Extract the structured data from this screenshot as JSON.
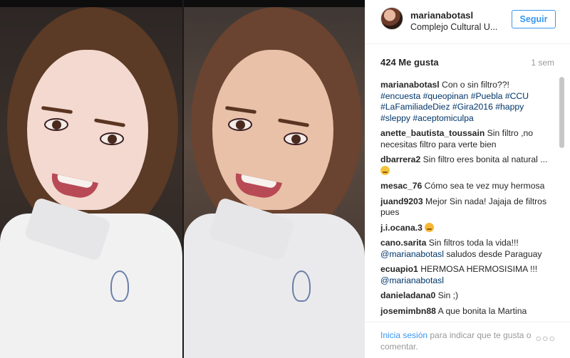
{
  "post": {
    "username": "marianabotasl",
    "location": "Complejo Cultural U...",
    "follow_label": "Seguir",
    "likes": "424 Me gusta",
    "time": "1 sem"
  },
  "caption": {
    "user": "marianabotasl",
    "text": " Con o sin filtro??! ",
    "tags": "#encuesta #queopinan #Puebla #CCU #LaFamiliadeDiez #Gira2016 #happy #sleppy #aceptomiculpa"
  },
  "comments": [
    {
      "user": "anette_bautista_toussain",
      "text": " Sin filtro ,no necesitas filtro para verte bien",
      "mention": ""
    },
    {
      "user": "dbarrera2",
      "text": " Sin filtro eres bonita al natural ...",
      "mention": "",
      "emoji": "smirk-emoji"
    },
    {
      "user": "mesac_76",
      "text": " Cómo sea te vez muy hermosa",
      "mention": ""
    },
    {
      "user": "juand9203",
      "text": " Mejor Sin nada! Jajaja de filtros pues",
      "mention": ""
    },
    {
      "user": "j.i.ocana.3",
      "text": " ",
      "mention": "",
      "emoji": "kiss-emoji"
    },
    {
      "user": "cano.sarita",
      "text": " Sin filtros toda la vida!!! ",
      "mention": "@marianabotasl",
      "after": " saludos desde Paraguay"
    },
    {
      "user": "ecuapio1",
      "text": " HERMOSA HERMOSISIMA !!! ",
      "mention": "@marianabotasl"
    },
    {
      "user": "danieladana0",
      "text": " Sin ;)",
      "mention": ""
    },
    {
      "user": "josemimbn88",
      "text": " A que bonita la Martina",
      "mention": ""
    }
  ],
  "footer": {
    "login_link": "Inicia sesión",
    "login_text": " para indicar que te gusta o comentar.",
    "more_icon": "more-options-icon"
  },
  "colors": {
    "accent": "#3897f0",
    "link": "#003569",
    "muted": "#999999"
  }
}
